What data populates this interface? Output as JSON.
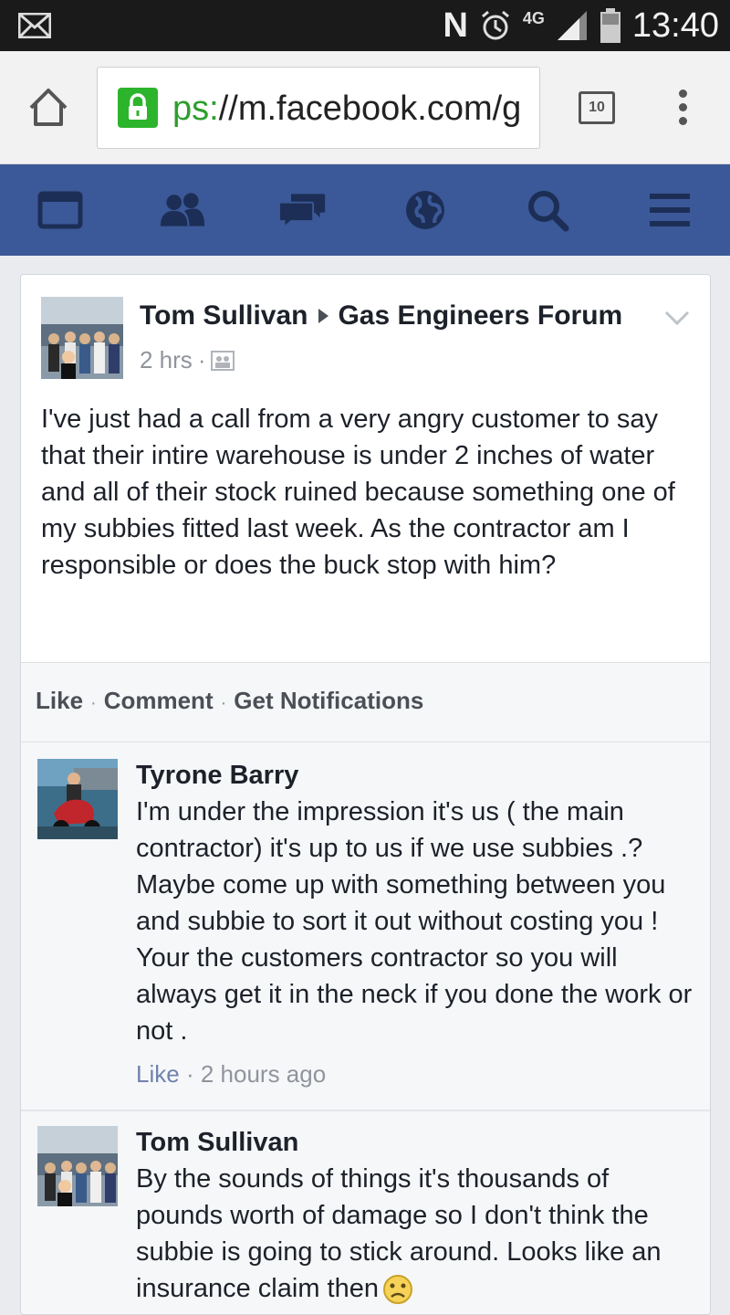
{
  "status_bar": {
    "time": "13:40",
    "network": "4G",
    "notification_icons": [
      "mail-icon",
      "nfc-icon",
      "alarm-icon",
      "signal-icon",
      "battery-icon"
    ]
  },
  "browser": {
    "url_scheme_visible": "ps:",
    "url_rest": "//m.facebook.com/g",
    "tab_count": "10"
  },
  "nav": {
    "icons": [
      "news-feed-icon",
      "friends-icon",
      "messages-icon",
      "notifications-globe-icon",
      "search-icon",
      "menu-icon"
    ],
    "color": "#3b5998"
  },
  "post": {
    "author": "Tom Sullivan",
    "group": "Gas Engineers Forum",
    "time": "2 hrs",
    "body": "I've just had a call from a very angry customer to say that their intire warehouse is under 2 inches of water and all of their stock ruined because something one of my subbies fitted last week. As the contractor am I responsible or does the buck stop with him?",
    "actions": {
      "like": "Like",
      "comment": "Comment",
      "notifications": "Get Notifications"
    }
  },
  "comments": [
    {
      "author": "Tyrone Barry",
      "text": "I'm under the impression it's us ( the main contractor) it's up to us if we use subbies .? Maybe come up with something between you and subbie to sort it out without costing you ! Your the customers contractor so you will always get it in the neck if you done the work or not .",
      "like_label": "Like",
      "time": "2 hours ago"
    },
    {
      "author": "Tom Sullivan",
      "text": "By the sounds of things it's thousands of pounds worth of damage so I don't think the subbie is going to stick around. Looks like an insurance claim then"
    }
  ]
}
